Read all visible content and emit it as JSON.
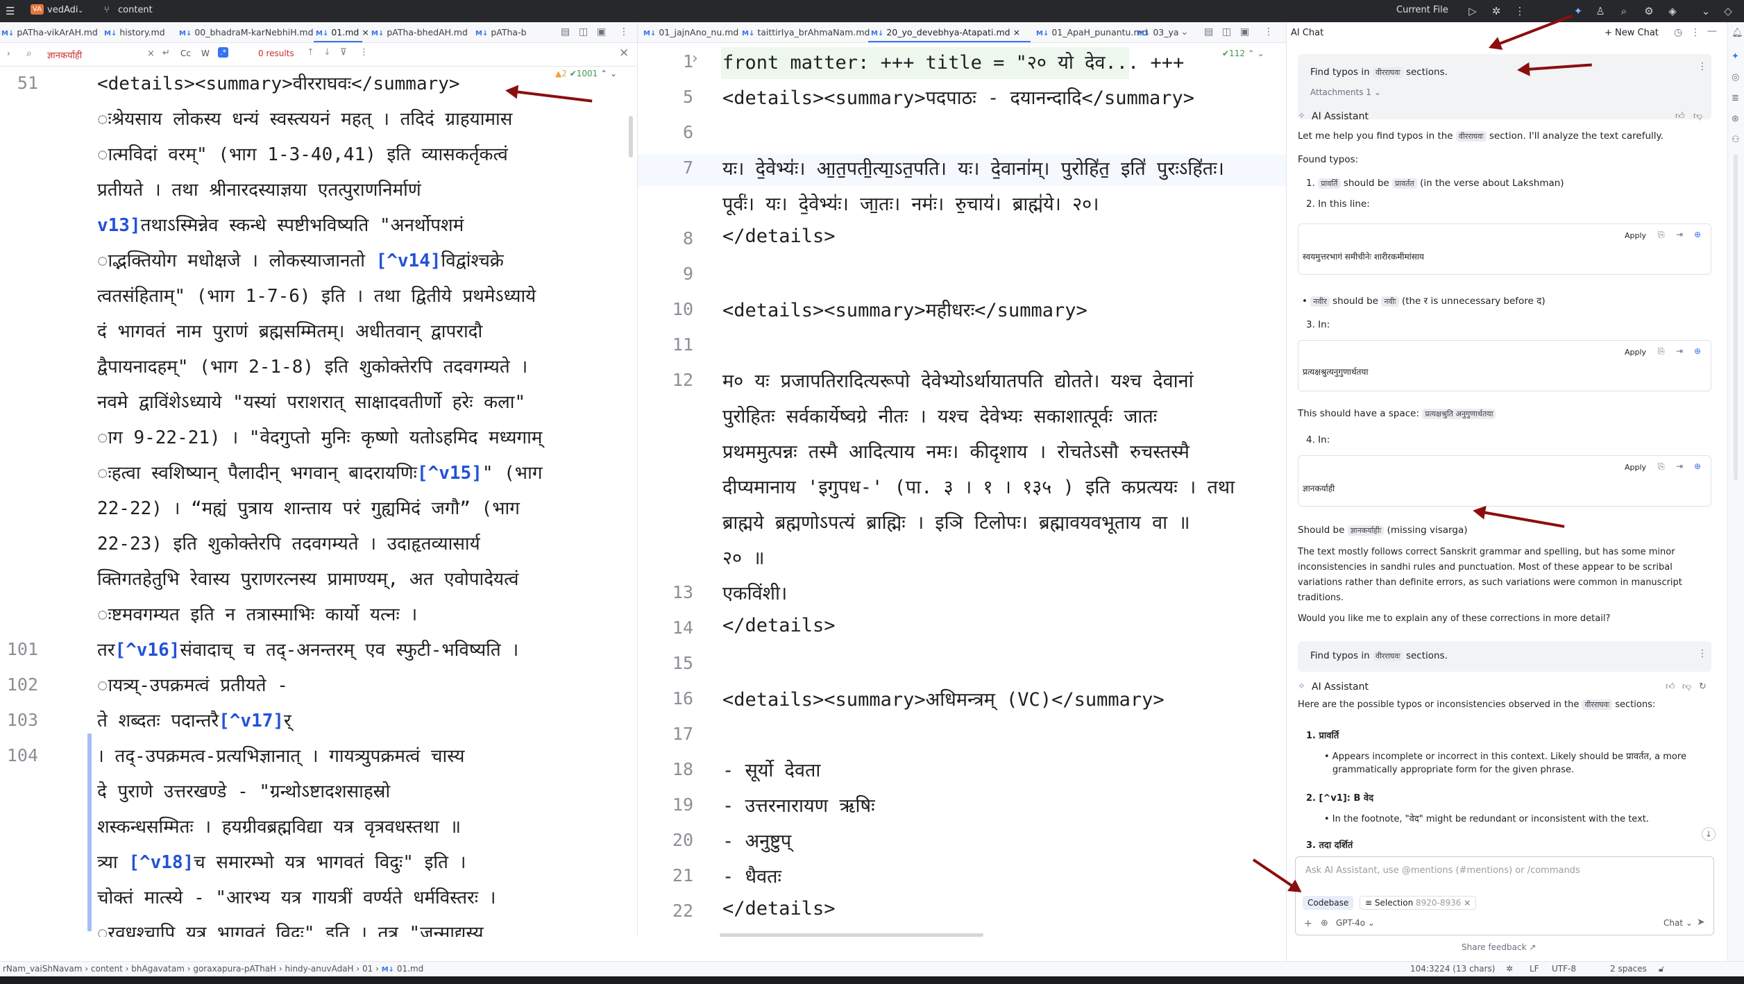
{
  "titlebar": {
    "project_badge": "VA",
    "project": "vedAdi",
    "branch": "content",
    "run_config": "Current File"
  },
  "left_tabs": [
    "pATha-vikArAH.md",
    "history.md",
    "00_bhadraM-karNebhiH.md",
    "01.md",
    "pATha-bhedAH.md",
    "pATha-b"
  ],
  "middle_tabs": [
    "01_jajnAno_nu.md",
    "taittirIya_brAhmaNam.md",
    "20_yo_devebhya-Atapati.md",
    "01_ApaH_punantu.md",
    "03_ya"
  ],
  "search": {
    "query": "ज्ञानकर्याही",
    "results": "0 results",
    "opt_cc": "Cc",
    "opt_w": "W",
    "opt_re": ".*"
  },
  "left_editor": {
    "warn": "▲2",
    "ok": "✔1001",
    "lines": [
      {
        "num": "51",
        "text": "<details><summary>वीरराघवः</summary>"
      },
      {
        "num": "",
        "text": "ःश्रेयसाय लोकस्य धन्यं स्वस्त्ययनं महत् । तदिदं ग्राहयामास"
      },
      {
        "num": "",
        "text": "ात्मविदां वरम्\" (भाग 1-3-40,41) इति व्यासकर्तृकत्वं"
      },
      {
        "num": "",
        "text": " प्रतीयते । तथा श्रीनारदस्याज्ञया एतत्पुराणनिर्माणं"
      },
      {
        "num": "",
        "text": "v13]तथाऽस्मिन्नेव स्कन्धे स्पष्टीभविष्यति \"अनर्थोपशमं"
      },
      {
        "num": "",
        "text": "ाद्भक्तियोग मधोक्षजे । लोकस्याजानतो [^v14]विद्वांश्चक्रे"
      },
      {
        "num": "",
        "text": "त्वतसंहिताम्\" (भाग 1-7-6) इति । तथा द्वितीये प्रथमेऽध्याये"
      },
      {
        "num": "",
        "text": "दं भागवतं नाम पुराणं ब्रह्मसम्मितम्। अधीतवान् द्वापरादौ"
      },
      {
        "num": "",
        "text": "द्वैपायनादहम्\" (भाग 2-1-8) इति शुकोक्तेरपि तदवगम्यते ।"
      },
      {
        "num": "",
        "text": " नवमे द्वाविंशेऽध्याये \"यस्यां पराशरात् साक्षादवतीर्णो हरेः कला\""
      },
      {
        "num": "",
        "text": "ाग 9-22-21) । \"वेदगुप्तो मुनिः कृष्णो यतोऽहमिद मध्यगाम्"
      },
      {
        "num": "",
        "text": "ःहत्वा स्वशिष्यान् पैलादीन् भगवान् बादरायणिः[^v15]\" (भाग"
      },
      {
        "num": "",
        "text": "22-22) । “मह्यं पुत्राय शान्ताय परं गुह्यमिदं जगौ” (भाग"
      },
      {
        "num": "",
        "text": "22-23) इति शुकोक्तेरपि तदवगम्यते । उदाहृतव्यासार्य"
      },
      {
        "num": "",
        "text": "क्तिगतहेतुभि रेवास्य पुराणरत्नस्य प्रामाण्यम्, अत एवोपादेयत्वं"
      },
      {
        "num": "",
        "text": "ःष्टमवगम्यत इति न तत्रास्माभिः कार्यो यत्नः ।"
      },
      {
        "num": "101",
        "text": "तर[^v16]संवादाच् च तद्-अनन्तरम् एव स्फुटी-भविष्यति ।"
      },
      {
        "num": "102",
        "text": "ायत्र्य्-उपक्रमत्वं प्रतीयते -"
      },
      {
        "num": "103",
        "text": "ते शब्दतः पदान्तरै[^v17]र्"
      },
      {
        "num": "104",
        "text": "। तद्-उपक्रमत्व-प्रत्यभिज्ञानात् । गायत्र्युपक्रमत्वं चास्य"
      },
      {
        "num": "",
        "text": "दे पुराणे उत्तरखण्डे - \"ग्रन्थोऽष्टादशसाहस्रो"
      },
      {
        "num": "",
        "text": "शस्कन्धसम्मितः । हयग्रीवब्रह्मविद्या यत्र वृत्रवधस्तथा ॥"
      },
      {
        "num": "",
        "text": "त्र्या [^v18]च समारम्भो यत्र भागवतं विदुः\" इति ।"
      },
      {
        "num": "",
        "text": "चोक्तं मात्स्ये - \"आरभ्य यत्र गायत्रीं वर्ण्यते धर्मविस्तरः ।"
      },
      {
        "num": "",
        "text": "ुरवधश्चापि यत्र भागवतं विदुः\" इति । तत्र \"जन्माद्यस्य"
      }
    ]
  },
  "middle_editor": {
    "count": "✔112",
    "lines": [
      {
        "num": "1",
        "text": "front matter: +++ title = \"२० यो देव...  +++"
      },
      {
        "num": "5",
        "text": "<details><summary>पदपाठः - दयानन्दादि</summary>"
      },
      {
        "num": "6",
        "text": ""
      },
      {
        "num": "7",
        "text": "यः। दे॒वेभ्यः॑। आ॒त॒पती॒त्या॒ऽत॒पति। यः। दे॒वाना॑म्। पु॒रोहि॑त॒ इति॑ पु॒रःऽहि॑तः।"
      },
      {
        "num": "",
        "text": " पूर्वः॑। यः। दे॒वेभ्यः॑। जा॒तः। नमः॑। रु॒चाय॑। ब्राह्म॑ये। २०।"
      },
      {
        "num": "8",
        "text": "</details>"
      },
      {
        "num": "9",
        "text": ""
      },
      {
        "num": "10",
        "text": "<details><summary>महीधरः</summary>"
      },
      {
        "num": "11",
        "text": ""
      },
      {
        "num": "12",
        "text": "म० यः प्रजापतिरादित्यरूपो देवेभ्योऽर्थायातपति द्योतते। यश्च देवानां"
      },
      {
        "num": "",
        "text": " पुरोहितः सर्वकार्येष्वग्रे नीतः । यश्च देवेभ्यः सकाशात्पूर्वः जातः"
      },
      {
        "num": "",
        "text": " प्रथममुत्पन्नः तस्मै आदित्याय नमः। कीदृशाय । रोचतेऽसौ रुचस्तस्मै"
      },
      {
        "num": "",
        "text": " दीप्यमानाय 'इगुपध-' (पा. ३ । १ । १३५ ) इति कप्रत्ययः । तथा"
      },
      {
        "num": "",
        "text": "  ब्राह्मये ब्रह्मणोऽपत्यं ब्राह्मिः । इञि टिलोपः। ब्रह्मावयवभूताय वा ॥"
      },
      {
        "num": "",
        "text": "  २० ॥"
      },
      {
        "num": "13",
        "text": "एकविंशी।"
      },
      {
        "num": "14",
        "text": "</details>"
      },
      {
        "num": "15",
        "text": ""
      },
      {
        "num": "16",
        "text": "<details><summary>अधिमन्त्रम् (VC)</summary>"
      },
      {
        "num": "17",
        "text": ""
      },
      {
        "num": "18",
        "text": "- सूर्यो देवता"
      },
      {
        "num": "19",
        "text": "- उत्तरनारायण ऋषिः"
      },
      {
        "num": "20",
        "text": "- अनुष्टुप्"
      },
      {
        "num": "21",
        "text": "- धैवतः"
      },
      {
        "num": "22",
        "text": "</details>"
      }
    ]
  },
  "chat": {
    "title": "AI Chat",
    "new_chat": "New Chat",
    "q1": {
      "pre": "Find typos in",
      "pill": "वीरराघवः",
      "post": "sections.",
      "attachments": "Attachments 1"
    },
    "assistant_name": "AI Assistant",
    "a1": {
      "intro_pre": "Let me help you find typos in the",
      "intro_pill": "वीरराघवः",
      "intro_post": "section. I'll analyze the text carefully.",
      "found": "Found typos:",
      "i1_pre": "1.",
      "i1_a": "प्रावर्ति",
      "i1_mid": "should be",
      "i1_b": "प्रावर्तत",
      "i1_post": "(in the verse about Lakshman)",
      "i2": "2. In this line:",
      "apply": "Apply",
      "code1": "स्वयमुत्तरभागं समीचीनेः शारीरकमीमांसाय",
      "b1_a": "नवीर",
      "b1_mid": "should be",
      "b1_b": "नवीः",
      "b1_post": "(the र is unnecessary before द)",
      "i3": "3. In:",
      "code2": "प्रत्यक्षश्रुत्यनुगुणार्थतया",
      "space_pre": "This should have a space:",
      "space_pill": "प्रत्यक्षश्रुति अनुगुणार्थतया",
      "i4": "4. In:",
      "code3": "ज्ञानकर्याही",
      "should_pre": "Should be",
      "should_pill": "ज्ञानकर्याहीः",
      "should_post": "(missing visarga)",
      "p1": "The text mostly follows correct Sanskrit grammar and spelling, but has some minor",
      "p2": "inconsistencies in sandhi rules and punctuation. Most of these appear to be scribal",
      "p3": "variations rather than definite errors, as such variations were common in manuscript",
      "p4": "traditions.",
      "p5": "Would you like me to explain any of these corrections in more detail?"
    },
    "q2": {
      "pre": "Find typos in",
      "pill": "वीरराघवः",
      "post": "sections."
    },
    "a2": {
      "intro_pre": "Here are the possible typos or inconsistencies observed in the",
      "intro_pill": "वीरराघवः",
      "intro_post": "sections:",
      "h1": "1. प्रावर्ति",
      "b1": "• Appears incomplete or incorrect in this context. Likely should be प्रावर्तत, a more",
      "b1b": "grammatically appropriate form for the given phrase.",
      "h2": "2. [^v1]: B वेद",
      "b2": "• In the footnote, \"वेद\" might be redundant or inconsistent with the text.",
      "h3": "3. तदा दर्शितं"
    },
    "input_placeholder": "Ask AI Assistant, use @mentions (#mentions) or /commands",
    "ctx_codebase": "Codebase",
    "ctx_selection": "Selection",
    "ctx_range": "8920-8936",
    "model": "GPT-4o",
    "mode": "Chat",
    "feedback": "Share feedback ↗"
  },
  "status": {
    "breadcrumb": [
      "rNam_vaiShNavam",
      "content",
      "bhAgavatam",
      "goraxapura-pAThaH",
      "hindy-anuvAdaH",
      "01",
      "01.md"
    ],
    "position": "104:3224 (13 chars)",
    "lf": "LF",
    "enc": "UTF-8",
    "indent": "2 spaces"
  },
  "colors": {
    "accent": "#3574f0",
    "arrow": "#8b0e0e",
    "footnote": "#2352d8"
  }
}
